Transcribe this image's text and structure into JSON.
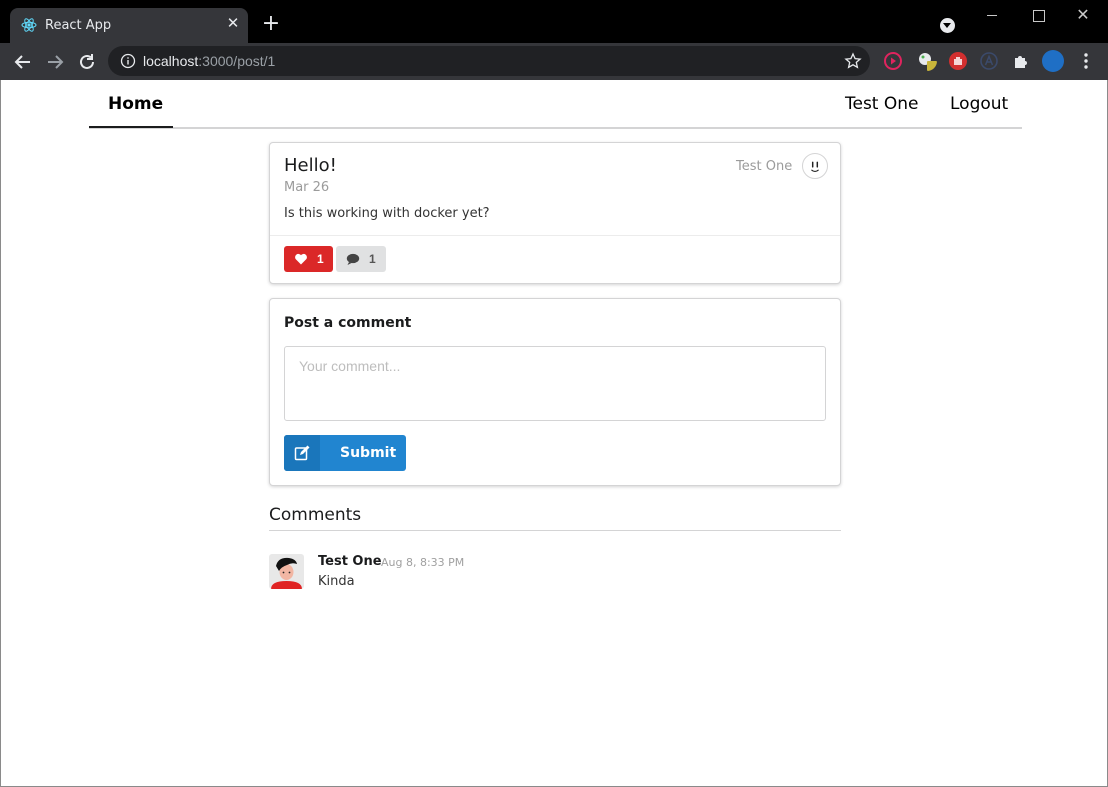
{
  "browser": {
    "tab_title": "React App",
    "tab_close": "✕",
    "new_tab": "+",
    "window_close": "✕",
    "url_host": "localhost",
    "url_path": ":3000/post/1",
    "icons": [
      "react-favicon",
      "back-arrow-icon",
      "forward-arrow-icon",
      "reload-icon",
      "site-info-icon",
      "bookmark-star-icon",
      "extensions-puzzle-icon",
      "menu-kebab-icon"
    ]
  },
  "nav": {
    "home": "Home",
    "user": "Test One",
    "logout": "Logout"
  },
  "post": {
    "title": "Hello!",
    "date": "Mar 26",
    "body": "Is this working with docker yet?",
    "author": "Test One",
    "likes": "1",
    "comments": "1"
  },
  "comment_form": {
    "title": "Post a comment",
    "placeholder": "Your comment...",
    "value": "",
    "submit_label": "Submit"
  },
  "comments": {
    "title": "Comments",
    "items": [
      {
        "author": "Test One",
        "time": "Aug 8, 8:33 PM",
        "text": "Kinda"
      }
    ]
  },
  "colors": {
    "like": "#db2828",
    "primary": "#2185d0",
    "chrome_bg": "#000000",
    "toolbar_bg": "#35363a"
  }
}
